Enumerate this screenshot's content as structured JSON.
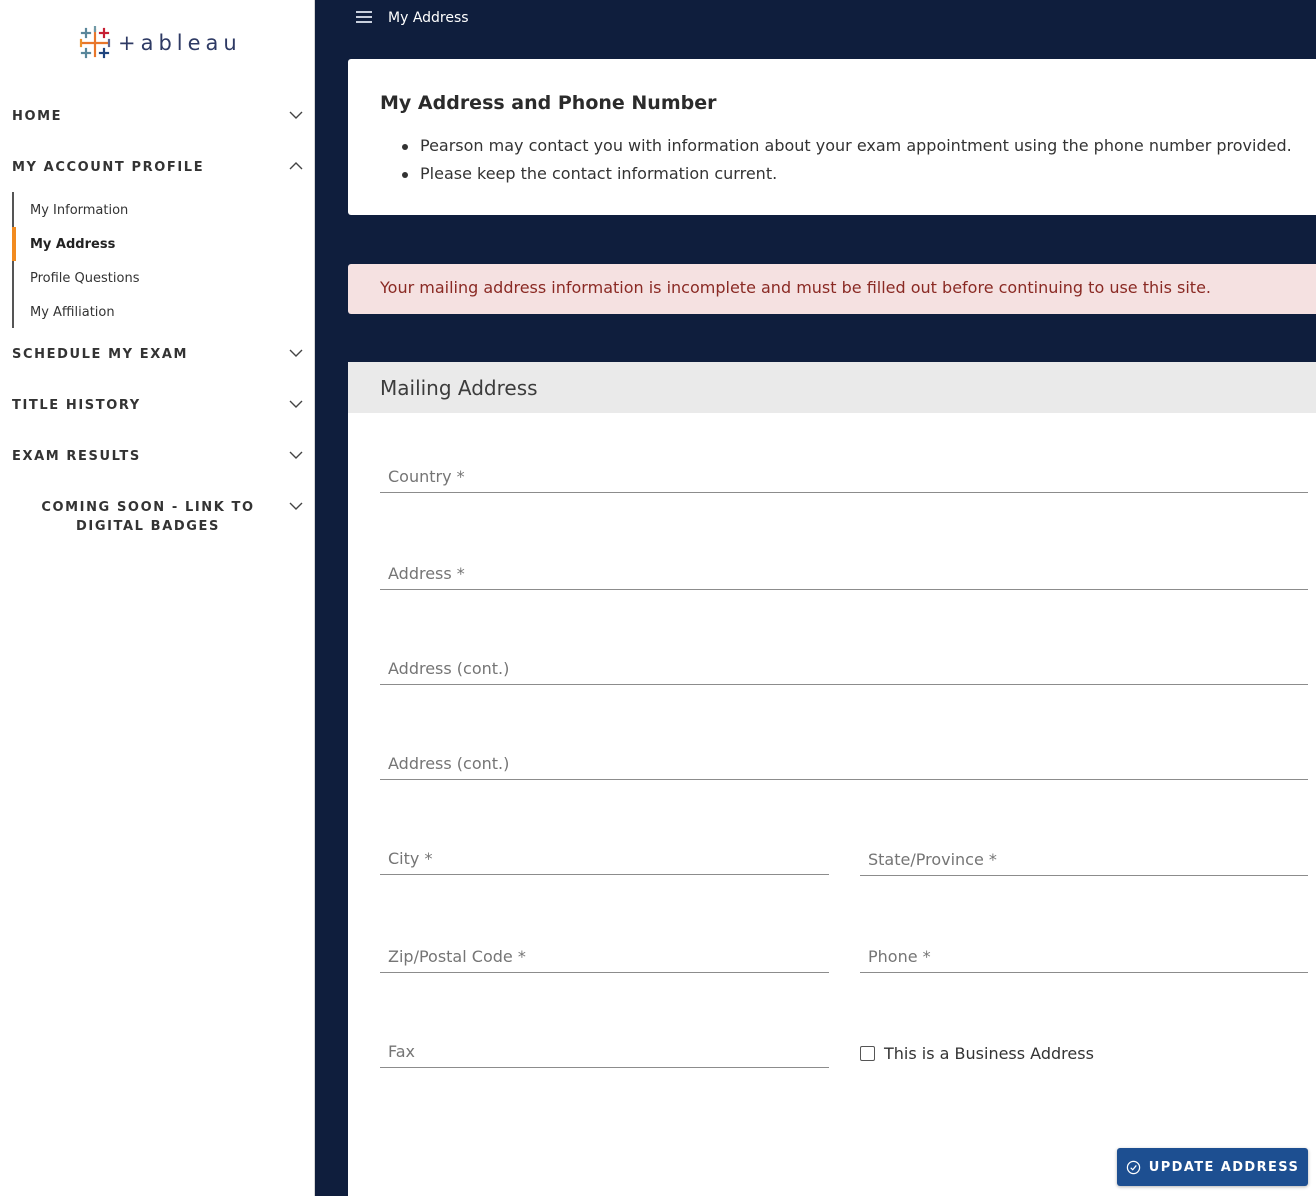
{
  "logo": {
    "text": "+ableau"
  },
  "sidebar": {
    "sections": [
      {
        "label": "HOME",
        "expanded": false
      },
      {
        "label": "MY ACCOUNT PROFILE",
        "expanded": true
      },
      {
        "label": "SCHEDULE MY EXAM",
        "expanded": false
      },
      {
        "label": "TITLE HISTORY",
        "expanded": false
      },
      {
        "label": "EXAM RESULTS",
        "expanded": false
      },
      {
        "label": "COMING SOON - LINK TO DIGITAL BADGES",
        "expanded": false
      }
    ],
    "subitems": [
      {
        "label": "My Information",
        "active": false
      },
      {
        "label": "My Address",
        "active": true
      },
      {
        "label": "Profile Questions",
        "active": false
      },
      {
        "label": "My Affiliation",
        "active": false
      }
    ]
  },
  "header": {
    "breadcrumb": "My Address"
  },
  "info": {
    "title": "My Address and Phone Number",
    "bullets": [
      "Pearson may contact you with information about your exam appointment using the phone number provided.",
      "Please keep the contact information current."
    ]
  },
  "alert": {
    "text": "Your mailing address information is incomplete and must be filled out before continuing to use this site."
  },
  "form": {
    "title": "Mailing Address",
    "fields": {
      "country": {
        "placeholder": "Country *",
        "value": ""
      },
      "address1": {
        "placeholder": "Address *",
        "value": ""
      },
      "address2": {
        "placeholder": "Address (cont.)",
        "value": ""
      },
      "address3": {
        "placeholder": "Address (cont.)",
        "value": ""
      },
      "city": {
        "placeholder": "City *",
        "value": ""
      },
      "state": {
        "placeholder": "State/Province *",
        "value": ""
      },
      "zip": {
        "placeholder": "Zip/Postal Code *",
        "value": ""
      },
      "phone": {
        "placeholder": "Phone *",
        "value": ""
      },
      "fax": {
        "placeholder": "Fax",
        "value": ""
      }
    },
    "business_checkbox": {
      "label": "This is a Business Address",
      "checked": false
    },
    "submit_label": "UPDATE ADDRESS"
  },
  "colors": {
    "background": "#0f1e3d",
    "accent": "#f28b1f",
    "button": "#1d4f91",
    "alert_bg": "#f5e1e1",
    "alert_text": "#8a2a24"
  }
}
